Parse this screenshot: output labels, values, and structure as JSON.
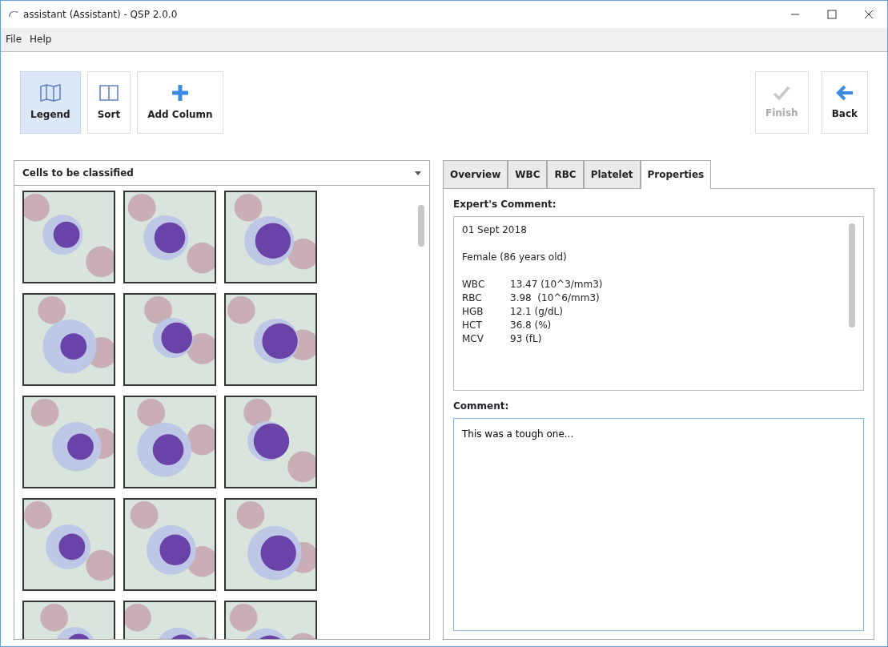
{
  "window": {
    "title": "assistant (Assistant) - QSP 2.0.0"
  },
  "menu": [
    "File",
    "Help"
  ],
  "toolbar_left": [
    {
      "label": "Legend",
      "kind": "map",
      "selected": true,
      "disabled": false
    },
    {
      "label": "Sort",
      "kind": "columns",
      "selected": false,
      "disabled": false
    },
    {
      "label": "Add Column",
      "kind": "plus",
      "selected": false,
      "disabled": false
    }
  ],
  "toolbar_right": [
    {
      "label": "Finish",
      "kind": "check",
      "selected": false,
      "disabled": true
    },
    {
      "label": "Back",
      "kind": "arrow",
      "selected": false,
      "disabled": false
    }
  ],
  "cell_panel": {
    "dropdown": "Cells to be classified"
  },
  "tabs": [
    {
      "label": "Overview",
      "selected": false
    },
    {
      "label": "WBC",
      "selected": false
    },
    {
      "label": "RBC",
      "selected": false
    },
    {
      "label": "Platelet",
      "selected": false
    },
    {
      "label": "Properties",
      "selected": true
    }
  ],
  "expert_comment": {
    "label": "Expert's Comment:",
    "lines": [
      {
        "kind": "text",
        "text": "01 Sept 2018"
      },
      {
        "kind": "blank"
      },
      {
        "kind": "text",
        "text": "Female (86 years old)"
      },
      {
        "kind": "blank"
      },
      {
        "kind": "value",
        "name": "WBC",
        "value": "13.47 (10^3/mm3)"
      },
      {
        "kind": "value",
        "name": "RBC",
        "value": "3.98  (10^6/mm3)"
      },
      {
        "kind": "value",
        "name": "HGB",
        "value": "12.1 (g/dL)"
      },
      {
        "kind": "value",
        "name": "HCT",
        "value": "36.8 (%)"
      },
      {
        "kind": "value",
        "name": "MCV",
        "value": "93 (fL)"
      }
    ]
  },
  "comment": {
    "label": "Comment:",
    "value": "This was a tough one..."
  }
}
